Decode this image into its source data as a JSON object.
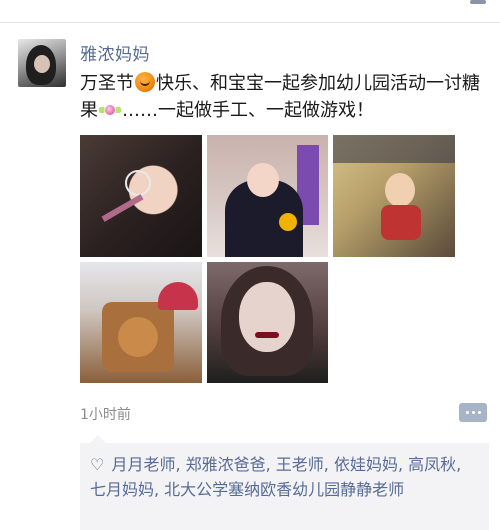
{
  "post": {
    "username": "雅浓妈妈",
    "text_part1": "万圣节",
    "text_part2": "快乐、和宝宝一起参加幼儿园活动一讨糖果",
    "text_part3": "……一起做手工、一起做游戏！",
    "time": "1小时前"
  },
  "icons": {
    "pumpkin": "pumpkin-emoji",
    "candy": "candy-emoji",
    "heart": "heart-icon",
    "comment": "comment-icon"
  },
  "likes": {
    "heart_glyph": "♡",
    "names": "月月老师, 郑雅浓爸爸, 王老师, 依娃妈妈, 高凤秋, 七月妈妈, 北大公学塞纳欧香幼儿园静静老师"
  },
  "colors": {
    "link": "#576b95",
    "text": "#1a1a1a",
    "muted": "#8c8c8c",
    "likes_bg": "#f3f3f5"
  }
}
